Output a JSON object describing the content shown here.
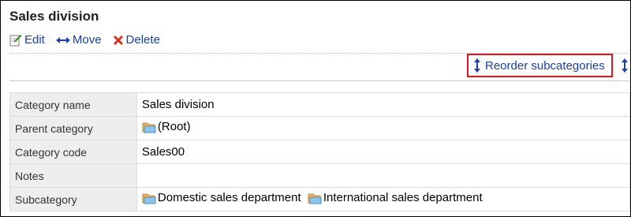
{
  "page": {
    "title": "Sales division"
  },
  "toolbar": {
    "edit_label": "Edit",
    "move_label": "Move",
    "delete_label": "Delete"
  },
  "actions": {
    "reorder_label": "Reorder subcategories"
  },
  "details": {
    "rows": [
      {
        "label": "Category name",
        "value": "Sales division"
      },
      {
        "label": "Parent category",
        "value": "(Root)"
      },
      {
        "label": "Category code",
        "value": "Sales00"
      },
      {
        "label": "Notes",
        "value": ""
      },
      {
        "label": "Subcategory",
        "value": ""
      }
    ],
    "subcategories": [
      "Domestic sales department",
      "International sales department"
    ]
  },
  "colors": {
    "link": "#1a3fb0",
    "highlight_border": "#e2141f",
    "label_bg": "#eeeeee"
  }
}
